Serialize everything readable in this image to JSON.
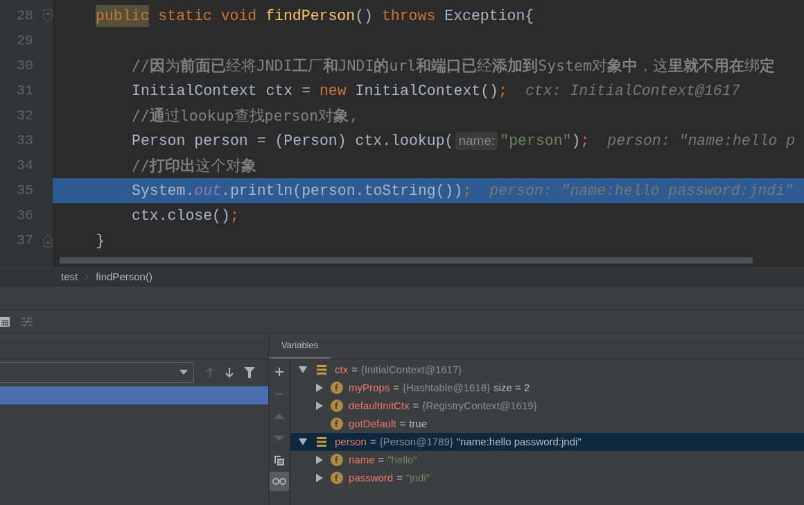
{
  "editor": {
    "lines": [
      {
        "number": "28",
        "kind": "method-start",
        "selected": false,
        "tokens": [
          {
            "kind": "keyword",
            "text": "public",
            "highlight": true
          },
          {
            "kind": "keyword",
            "text": " static void "
          },
          {
            "kind": "method",
            "text": "findPerson"
          },
          {
            "kind": "plain",
            "text": "() "
          },
          {
            "kind": "keyword",
            "text": "throws "
          },
          {
            "kind": "plain",
            "text": "Exception{"
          }
        ]
      },
      {
        "number": "29",
        "kind": "body",
        "selected": false
      },
      {
        "number": "30",
        "kind": "body",
        "selected": false,
        "tokens": [
          {
            "kind": "comment",
            "text": "//**因**为**前面已**经将JNDI**工**厂**和**JNDI**的**url**和端口已**经**添加到**System对**象中**，这**里就不用在**绑**定**"
          }
        ]
      },
      {
        "number": "31",
        "kind": "body",
        "selected": false,
        "tokens": [
          {
            "kind": "plain",
            "text": "InitialContext ctx = "
          },
          {
            "kind": "keyword",
            "text": "new "
          },
          {
            "kind": "plain",
            "text": "InitialContext()"
          },
          {
            "kind": "keyword",
            "text": ";"
          },
          {
            "kind": "hint",
            "text": "ctx: InitialContext@1617"
          }
        ]
      },
      {
        "number": "32",
        "kind": "body",
        "selected": false,
        "tokens": [
          {
            "kind": "comment",
            "text": "//**通**过lookup查找person对**象**,"
          }
        ]
      },
      {
        "number": "33",
        "kind": "body",
        "selected": false,
        "tokens": [
          {
            "kind": "plain",
            "text": "Person person = (Person) ctx.lookup("
          },
          {
            "kind": "param",
            "text": "name:"
          },
          {
            "kind": "string",
            "text": "\"person\""
          },
          {
            "kind": "plain",
            "text": ")"
          },
          {
            "kind": "keyword",
            "text": ";"
          },
          {
            "kind": "hint",
            "text": "person: \"name:hello p"
          }
        ]
      },
      {
        "number": "34",
        "kind": "body",
        "selected": false,
        "tokens": [
          {
            "kind": "comment",
            "text": "//**打印出**这个对**象**"
          }
        ]
      },
      {
        "number": "35",
        "kind": "body",
        "selected": true,
        "tokens": [
          {
            "kind": "plain",
            "text": "System."
          },
          {
            "kind": "static",
            "text": "out"
          },
          {
            "kind": "plain",
            "text": ".println(person.toString())"
          },
          {
            "kind": "keyword",
            "text": ";"
          },
          {
            "kind": "hint",
            "text": "person: \"name:hello password:jndi\""
          }
        ]
      },
      {
        "number": "36",
        "kind": "body",
        "selected": false,
        "tokens": [
          {
            "kind": "plain",
            "text": "ctx.close()"
          },
          {
            "kind": "keyword",
            "text": ";"
          }
        ]
      },
      {
        "number": "37",
        "kind": "method-end",
        "selected": false,
        "tokens": [
          {
            "kind": "plain",
            "text": "}"
          }
        ]
      }
    ]
  },
  "breadcrumb": [
    "test",
    "findPerson()"
  ],
  "frames": {
    "rows": [
      {
        "selected": true
      }
    ]
  },
  "variables": {
    "title": "Variables",
    "toolbar": [
      {
        "kind": "add",
        "disabled": false
      },
      {
        "kind": "remove",
        "disabled": true
      },
      {
        "kind": "up",
        "disabled": true
      },
      {
        "kind": "down",
        "disabled": true
      },
      {
        "kind": "copy",
        "disabled": false
      },
      {
        "kind": "watches",
        "on": true
      }
    ],
    "items": [
      {
        "kind": "object",
        "name": "ctx",
        "equals": "=",
        "ref": "{InitialContext@1617}",
        "expanded": true,
        "selected": false,
        "children": [
          {
            "kind": "field",
            "name": "myProps",
            "equals": "=",
            "ref": "{Hashtable@1618}",
            "value": {
              "kind": "plain",
              "text": "size = 2"
            },
            "expanded": false,
            "selected": false
          },
          {
            "kind": "field",
            "name": "defaultInitCtx",
            "equals": "=",
            "ref": "{RegistryContext@1619}",
            "expanded": false,
            "selected": false
          },
          {
            "kind": "field",
            "name": "gotDefault",
            "equals": "=",
            "value": {
              "kind": "plain",
              "text": "true"
            },
            "selected": false
          }
        ]
      },
      {
        "kind": "object",
        "name": "person",
        "equals": "=",
        "ref": "{Person@1789}",
        "value": {
          "kind": "plain",
          "text": "\"name:hello password:jndi\""
        },
        "expanded": true,
        "selected": true,
        "children": [
          {
            "kind": "field",
            "name": "name",
            "equals": "=",
            "value": {
              "kind": "string",
              "text": "\"hello\""
            },
            "expanded": false,
            "selected": false
          },
          {
            "kind": "field",
            "name": "password",
            "equals": "=",
            "value": {
              "kind": "string",
              "text": "\"jndi\""
            },
            "expanded": false,
            "selected": false
          }
        ]
      }
    ]
  }
}
